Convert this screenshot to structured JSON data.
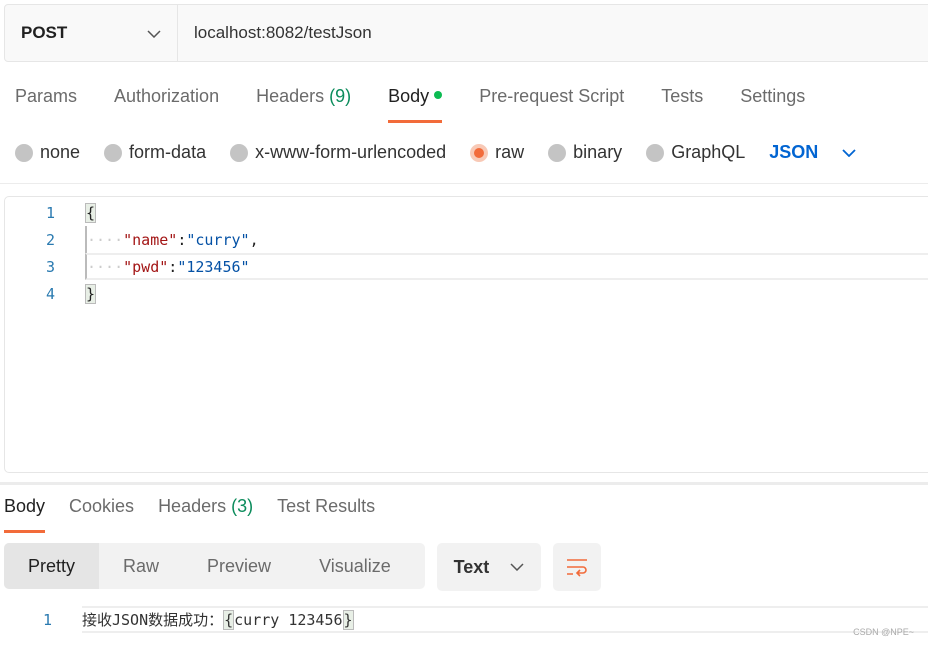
{
  "request": {
    "method": "POST",
    "url": "localhost:8082/testJson"
  },
  "tabs": [
    {
      "label": "Params"
    },
    {
      "label": "Authorization"
    },
    {
      "label": "Headers",
      "count": "(9)"
    },
    {
      "label": "Body"
    },
    {
      "label": "Pre-request Script"
    },
    {
      "label": "Tests"
    },
    {
      "label": "Settings"
    }
  ],
  "body_types": [
    "none",
    "form-data",
    "x-www-form-urlencoded",
    "raw",
    "binary",
    "GraphQL"
  ],
  "selected_body_type": "raw",
  "language": "JSON",
  "editor": {
    "lines": [
      {
        "n": "1",
        "open": "{"
      },
      {
        "n": "2",
        "ws": "····",
        "key": "\"name\"",
        "colon": ":",
        "val": "\"curry\"",
        "comma": ","
      },
      {
        "n": "3",
        "ws": "····",
        "key": "\"pwd\"",
        "colon": ":",
        "val": "\"123456\"",
        "comma": ""
      },
      {
        "n": "4",
        "open": "}"
      }
    ]
  },
  "response": {
    "tabs": [
      {
        "label": "Body"
      },
      {
        "label": "Cookies"
      },
      {
        "label": "Headers",
        "count": "(3)"
      },
      {
        "label": "Test Results"
      }
    ],
    "views": [
      "Pretty",
      "Raw",
      "Preview",
      "Visualize"
    ],
    "format": "Text",
    "line_no": "1",
    "prefix": "接收JSON数据成功：",
    "ob": "{",
    "content": "curry 123456",
    "cb": "}"
  },
  "watermark": "CSDN @NPE~",
  "colors": {
    "accent": "#f26b3a",
    "link": "#0265d2"
  }
}
